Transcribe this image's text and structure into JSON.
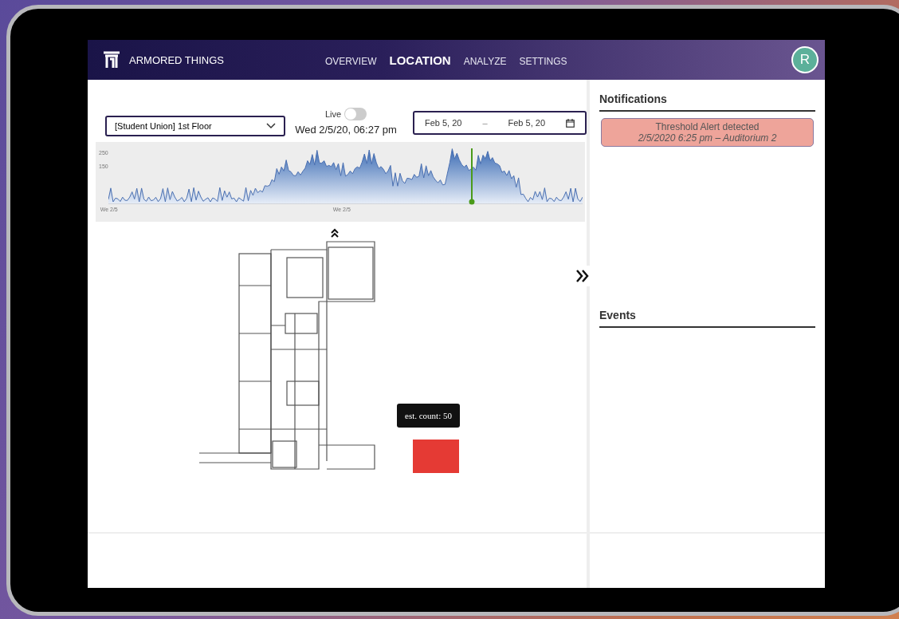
{
  "app": {
    "brand": "ARMORED THINGS",
    "avatar": "R"
  },
  "nav": [
    {
      "label": "OVERVIEW",
      "selected": false
    },
    {
      "label": "LOCATION",
      "selected": true
    },
    {
      "label": "ANALYZE",
      "selected": false
    },
    {
      "label": "SETTINGS",
      "selected": false
    }
  ],
  "controls": {
    "floor": "[Student Union] 1st Floor",
    "live": {
      "label": "Live",
      "on": false
    },
    "timestamp": "Wed 2/5/20, 06:27 pm",
    "date_from": "Feb 5, 20",
    "date_separator": "–",
    "date_to": "Feb 5, 20"
  },
  "timeline": {
    "y_labels": [
      "250",
      "150"
    ],
    "x_labels": [
      "We 2/5",
      "We 2/5"
    ]
  },
  "map": {
    "tooltip": "est. count: 50"
  },
  "notifications": {
    "title": "Notifications",
    "items": [
      {
        "title": "Threshold Alert detected",
        "detail": "2/5/2020 6:25 pm – Auditorium 2"
      }
    ]
  },
  "events": {
    "title": "Events"
  }
}
